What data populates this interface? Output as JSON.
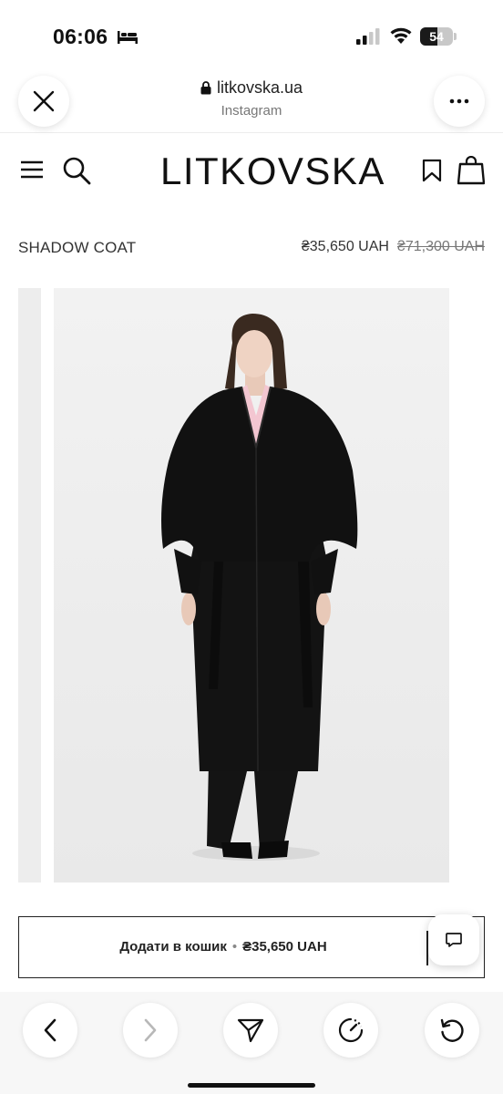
{
  "status_bar": {
    "time": "06:06",
    "battery_level": "54",
    "battery_fraction": 0.54
  },
  "browser": {
    "url": "litkovska.ua",
    "source": "Instagram",
    "close_icon": "close-icon",
    "more_icon": "more-icon"
  },
  "site": {
    "logo": "LITKOVSKA",
    "icons": [
      "menu-icon",
      "search-icon",
      "bookmark-icon",
      "bag-icon"
    ]
  },
  "product": {
    "name": "SHADOW COAT",
    "price": "₴35,650 UAH",
    "old_price": "₴71,300 UAH",
    "image_alt": "model wearing black coat"
  },
  "cart": {
    "label": "Додати в кошик",
    "separator": "•",
    "price": "₴35,650 UAH"
  },
  "bottom_nav": {
    "icons": [
      "back-icon",
      "forward-icon",
      "send-icon",
      "speed-icon",
      "refresh-icon"
    ]
  }
}
